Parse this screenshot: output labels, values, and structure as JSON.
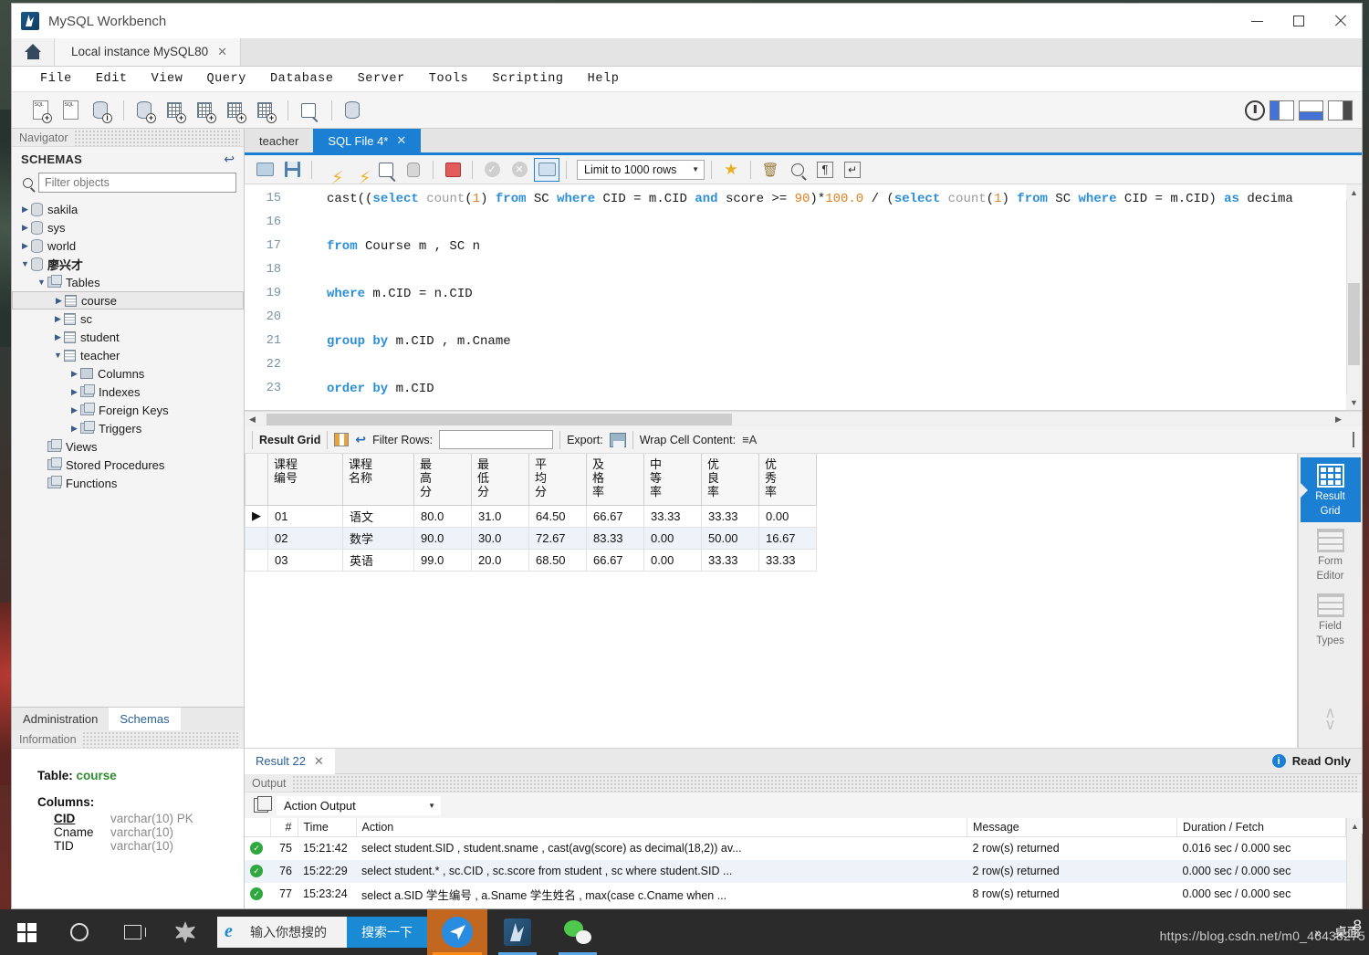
{
  "window": {
    "title": "MySQL Workbench",
    "app_icon": "dolphin-icon",
    "minimize": "minimize-icon",
    "maximize": "maximize-icon",
    "close": "close-icon"
  },
  "connection_tabs": {
    "home_label": "home-icon",
    "tabs": [
      {
        "label": "Local instance MySQL80",
        "closable": true
      }
    ]
  },
  "menubar": {
    "items": [
      "File",
      "Edit",
      "View",
      "Query",
      "Database",
      "Server",
      "Tools",
      "Scripting",
      "Help"
    ]
  },
  "main_toolbar": {
    "icons": [
      "new-sql-tab-icon",
      "open-sql-script-icon",
      "open-connection-info-icon",
      "new-schema-icon",
      "new-table-icon",
      "new-view-icon",
      "new-procedure-icon",
      "new-function-icon",
      "search-table-data-icon",
      "reconnect-server-icon"
    ],
    "right_icons": [
      "help-icon",
      "toggle-left-panel-icon",
      "toggle-output-panel-icon",
      "toggle-right-panel-icon"
    ]
  },
  "navigator": {
    "pane_title": "Navigator",
    "section_title": "SCHEMAS",
    "refresh_icon": "refresh-icon",
    "filter_placeholder": "Filter objects",
    "filter_value": "",
    "tree": [
      {
        "label": "sakila",
        "icon": "schema-icon",
        "indent": 0,
        "expanded": false,
        "selected": false
      },
      {
        "label": "sys",
        "icon": "schema-icon",
        "indent": 0,
        "expanded": false,
        "selected": false
      },
      {
        "label": "world",
        "icon": "schema-icon",
        "indent": 0,
        "expanded": false,
        "selected": false
      },
      {
        "label": "廖兴才",
        "icon": "schema-icon",
        "indent": 0,
        "expanded": true,
        "selected": false,
        "bold": true
      },
      {
        "label": "Tables",
        "icon": "folder-icon",
        "indent": 1,
        "expanded": true,
        "selected": false
      },
      {
        "label": "course",
        "icon": "table-icon",
        "indent": 2,
        "expanded": false,
        "selected": true
      },
      {
        "label": "sc",
        "icon": "table-icon",
        "indent": 2,
        "expanded": false,
        "selected": false
      },
      {
        "label": "student",
        "icon": "table-icon",
        "indent": 2,
        "expanded": false,
        "selected": false
      },
      {
        "label": "teacher",
        "icon": "table-icon",
        "indent": 2,
        "expanded": true,
        "selected": false
      },
      {
        "label": "Columns",
        "icon": "columns-icon",
        "indent": 3,
        "expanded": false,
        "selected": false
      },
      {
        "label": "Indexes",
        "icon": "folder-icon",
        "indent": 3,
        "expanded": false,
        "selected": false
      },
      {
        "label": "Foreign Keys",
        "icon": "folder-icon",
        "indent": 3,
        "expanded": false,
        "selected": false
      },
      {
        "label": "Triggers",
        "icon": "folder-icon",
        "indent": 3,
        "expanded": false,
        "selected": false
      },
      {
        "label": "Views",
        "icon": "folder-icon",
        "indent": 1,
        "expanded": null,
        "selected": false
      },
      {
        "label": "Stored Procedures",
        "icon": "folder-icon",
        "indent": 1,
        "expanded": null,
        "selected": false
      },
      {
        "label": "Functions",
        "icon": "folder-icon",
        "indent": 1,
        "expanded": null,
        "selected": false
      }
    ],
    "bottom_tabs": [
      {
        "label": "Administration",
        "active": false
      },
      {
        "label": "Schemas",
        "active": true
      }
    ]
  },
  "information": {
    "pane_title": "Information",
    "table_label": "Table:",
    "table_name": "course",
    "columns_label": "Columns:",
    "columns": [
      {
        "name": "CID",
        "type": "varchar(10) PK",
        "pk": true
      },
      {
        "name": "Cname",
        "type": "varchar(10)",
        "pk": false
      },
      {
        "name": "TID",
        "type": "varchar(10)",
        "pk": false
      }
    ]
  },
  "editor": {
    "tabs": [
      {
        "label": "teacher",
        "active": false,
        "closable": false
      },
      {
        "label": "SQL File 4*",
        "active": true,
        "closable": true
      }
    ],
    "toolbar": {
      "icons": [
        "open-file-icon",
        "save-file-icon",
        "execute-icon",
        "execute-current-icon",
        "explain-icon",
        "stop-icon",
        "toggle-breakpoint-icon",
        "commit-icon",
        "rollback-icon",
        "autocommit-icon"
      ],
      "limit_label": "Limit to 1000 rows",
      "right_icons": [
        "beautify-icon",
        "clear-context-icon",
        "find-icon",
        "invisible-chars-icon",
        "wrap-lines-icon"
      ]
    },
    "lines": [
      {
        "n": "15",
        "tokens": [
          {
            "t": "cast((",
            "c": "pl"
          },
          {
            "t": "select",
            "c": "kw"
          },
          {
            "t": " ",
            "c": "pl"
          },
          {
            "t": "count",
            "c": "fn"
          },
          {
            "t": "(",
            "c": "pl"
          },
          {
            "t": "1",
            "c": "num"
          },
          {
            "t": ") ",
            "c": "pl"
          },
          {
            "t": "from",
            "c": "kw"
          },
          {
            "t": " SC ",
            "c": "pl"
          },
          {
            "t": "where",
            "c": "kw"
          },
          {
            "t": " CID = m.CID ",
            "c": "pl"
          },
          {
            "t": "and",
            "c": "kw"
          },
          {
            "t": " score >= ",
            "c": "pl"
          },
          {
            "t": "90",
            "c": "num"
          },
          {
            "t": ")*",
            "c": "pl"
          },
          {
            "t": "100.0",
            "c": "num"
          },
          {
            "t": " / (",
            "c": "pl"
          },
          {
            "t": "select",
            "c": "kw"
          },
          {
            "t": " ",
            "c": "pl"
          },
          {
            "t": "count",
            "c": "fn"
          },
          {
            "t": "(",
            "c": "pl"
          },
          {
            "t": "1",
            "c": "num"
          },
          {
            "t": ") ",
            "c": "pl"
          },
          {
            "t": "from",
            "c": "kw"
          },
          {
            "t": " SC ",
            "c": "pl"
          },
          {
            "t": "where",
            "c": "kw"
          },
          {
            "t": " CID = m.CID) ",
            "c": "pl"
          },
          {
            "t": "as",
            "c": "kw"
          },
          {
            "t": " decima",
            "c": "pl"
          }
        ]
      },
      {
        "n": "16",
        "tokens": []
      },
      {
        "n": "17",
        "tokens": [
          {
            "t": "from",
            "c": "kw"
          },
          {
            "t": " Course m , SC n",
            "c": "pl"
          }
        ]
      },
      {
        "n": "18",
        "tokens": []
      },
      {
        "n": "19",
        "tokens": [
          {
            "t": "where",
            "c": "kw"
          },
          {
            "t": " m.CID = n.CID",
            "c": "pl"
          }
        ]
      },
      {
        "n": "20",
        "tokens": []
      },
      {
        "n": "21",
        "tokens": [
          {
            "t": "group by",
            "c": "kw"
          },
          {
            "t": " m.CID , m.Cname",
            "c": "pl"
          }
        ]
      },
      {
        "n": "22",
        "tokens": []
      },
      {
        "n": "23",
        "tokens": [
          {
            "t": "order by",
            "c": "kw"
          },
          {
            "t": " m.CID",
            "c": "pl"
          }
        ]
      }
    ]
  },
  "result_toolbar": {
    "grid_label": "Result Grid",
    "filter_label": "Filter Rows:",
    "filter_value": "",
    "export_label": "Export:",
    "wrap_label": "Wrap Cell Content:",
    "icons": [
      "grid-view-icon",
      "refresh-icon",
      "export-icon",
      "wrap-cell-icon",
      "maximize-grid-icon"
    ]
  },
  "result_grid": {
    "columns": [
      "课程编号",
      "课程名称",
      "最高分",
      "最低分",
      "平均分",
      "及格率",
      "中等率",
      "优良率",
      "优秀率"
    ],
    "rows": [
      {
        "selected": true,
        "cells": [
          "01",
          "语文",
          "80.0",
          "31.0",
          "64.50",
          "66.67",
          "33.33",
          "33.33",
          "0.00"
        ]
      },
      {
        "selected": false,
        "cells": [
          "02",
          "数学",
          "90.0",
          "30.0",
          "72.67",
          "83.33",
          "0.00",
          "50.00",
          "16.67"
        ]
      },
      {
        "selected": false,
        "cells": [
          "03",
          "英语",
          "99.0",
          "20.0",
          "68.50",
          "66.67",
          "0.00",
          "33.33",
          "33.33"
        ]
      }
    ]
  },
  "result_side": {
    "items": [
      {
        "label": "Result\nGrid",
        "line1": "Result",
        "line2": "Grid",
        "icon": "result-grid-icon",
        "active": true
      },
      {
        "label": "Form Editor",
        "line1": "Form",
        "line2": "Editor",
        "icon": "form-editor-icon",
        "active": false
      },
      {
        "label": "Field Types",
        "line1": "Field",
        "line2": "Types",
        "icon": "field-types-icon",
        "active": false
      }
    ],
    "updown_icon": "chevron-updown-icon"
  },
  "result_tabs": {
    "tabs": [
      {
        "label": "Result 22",
        "closable": true
      }
    ],
    "readonly_label": "Read Only",
    "info_icon": "info-icon"
  },
  "output": {
    "pane_title": "Output",
    "stack_icon": "output-stack-icon",
    "selector_value": "Action Output",
    "headers": [
      "#",
      "Time",
      "Action",
      "Message",
      "Duration / Fetch"
    ],
    "rows": [
      {
        "status": "success",
        "num": "75",
        "time": "15:21:42",
        "action": "select student.SID , student.sname , cast(avg(score) as decimal(18,2)) av...",
        "message": "2 row(s) returned",
        "duration": "0.016 sec / 0.000 sec"
      },
      {
        "status": "success",
        "num": "76",
        "time": "15:22:29",
        "action": "select student.* , sc.CID , sc.score from student , sc  where student.SID ...",
        "message": "2 row(s) returned",
        "duration": "0.000 sec / 0.000 sec"
      },
      {
        "status": "success",
        "num": "77",
        "time": "15:23:24",
        "action": "select a.SID 学生编号 , a.Sname 学生姓名 , max(case c.Cname when ...",
        "message": "8 row(s) returned",
        "duration": "0.000 sec / 0.000 sec"
      }
    ]
  },
  "taskbar": {
    "start_icon": "windows-start-icon",
    "cortana_icon": "cortana-search-icon",
    "taskview_icon": "task-view-icon",
    "sogou_icon": "sogou-input-icon",
    "search": {
      "browser_icon": "internet-explorer-icon",
      "placeholder": "输入你想搜的",
      "button_label": "搜索一下"
    },
    "apps": [
      {
        "name": "dingtalk-icon",
        "running": true
      },
      {
        "name": "mysql-workbench-icon",
        "running": false,
        "open": true
      },
      {
        "name": "wechat-icon",
        "running": false,
        "open": true
      }
    ],
    "overflow_icon": "show-hidden-icons-icon",
    "desktop_label": "桌面",
    "watermark": "https://blog.csdn.net/m0_46438275",
    "watermark_badge": "8"
  },
  "colors": {
    "accent": "#1b7fd4",
    "title_bg": "#ffffff",
    "toolbar_bg": "#f5f5f5",
    "sidebar_bg": "#f4f4f4",
    "success": "#2fa83f",
    "keyword": "#2a8fd8",
    "number": "#e08020",
    "taskbar": "#2b2b2b"
  }
}
